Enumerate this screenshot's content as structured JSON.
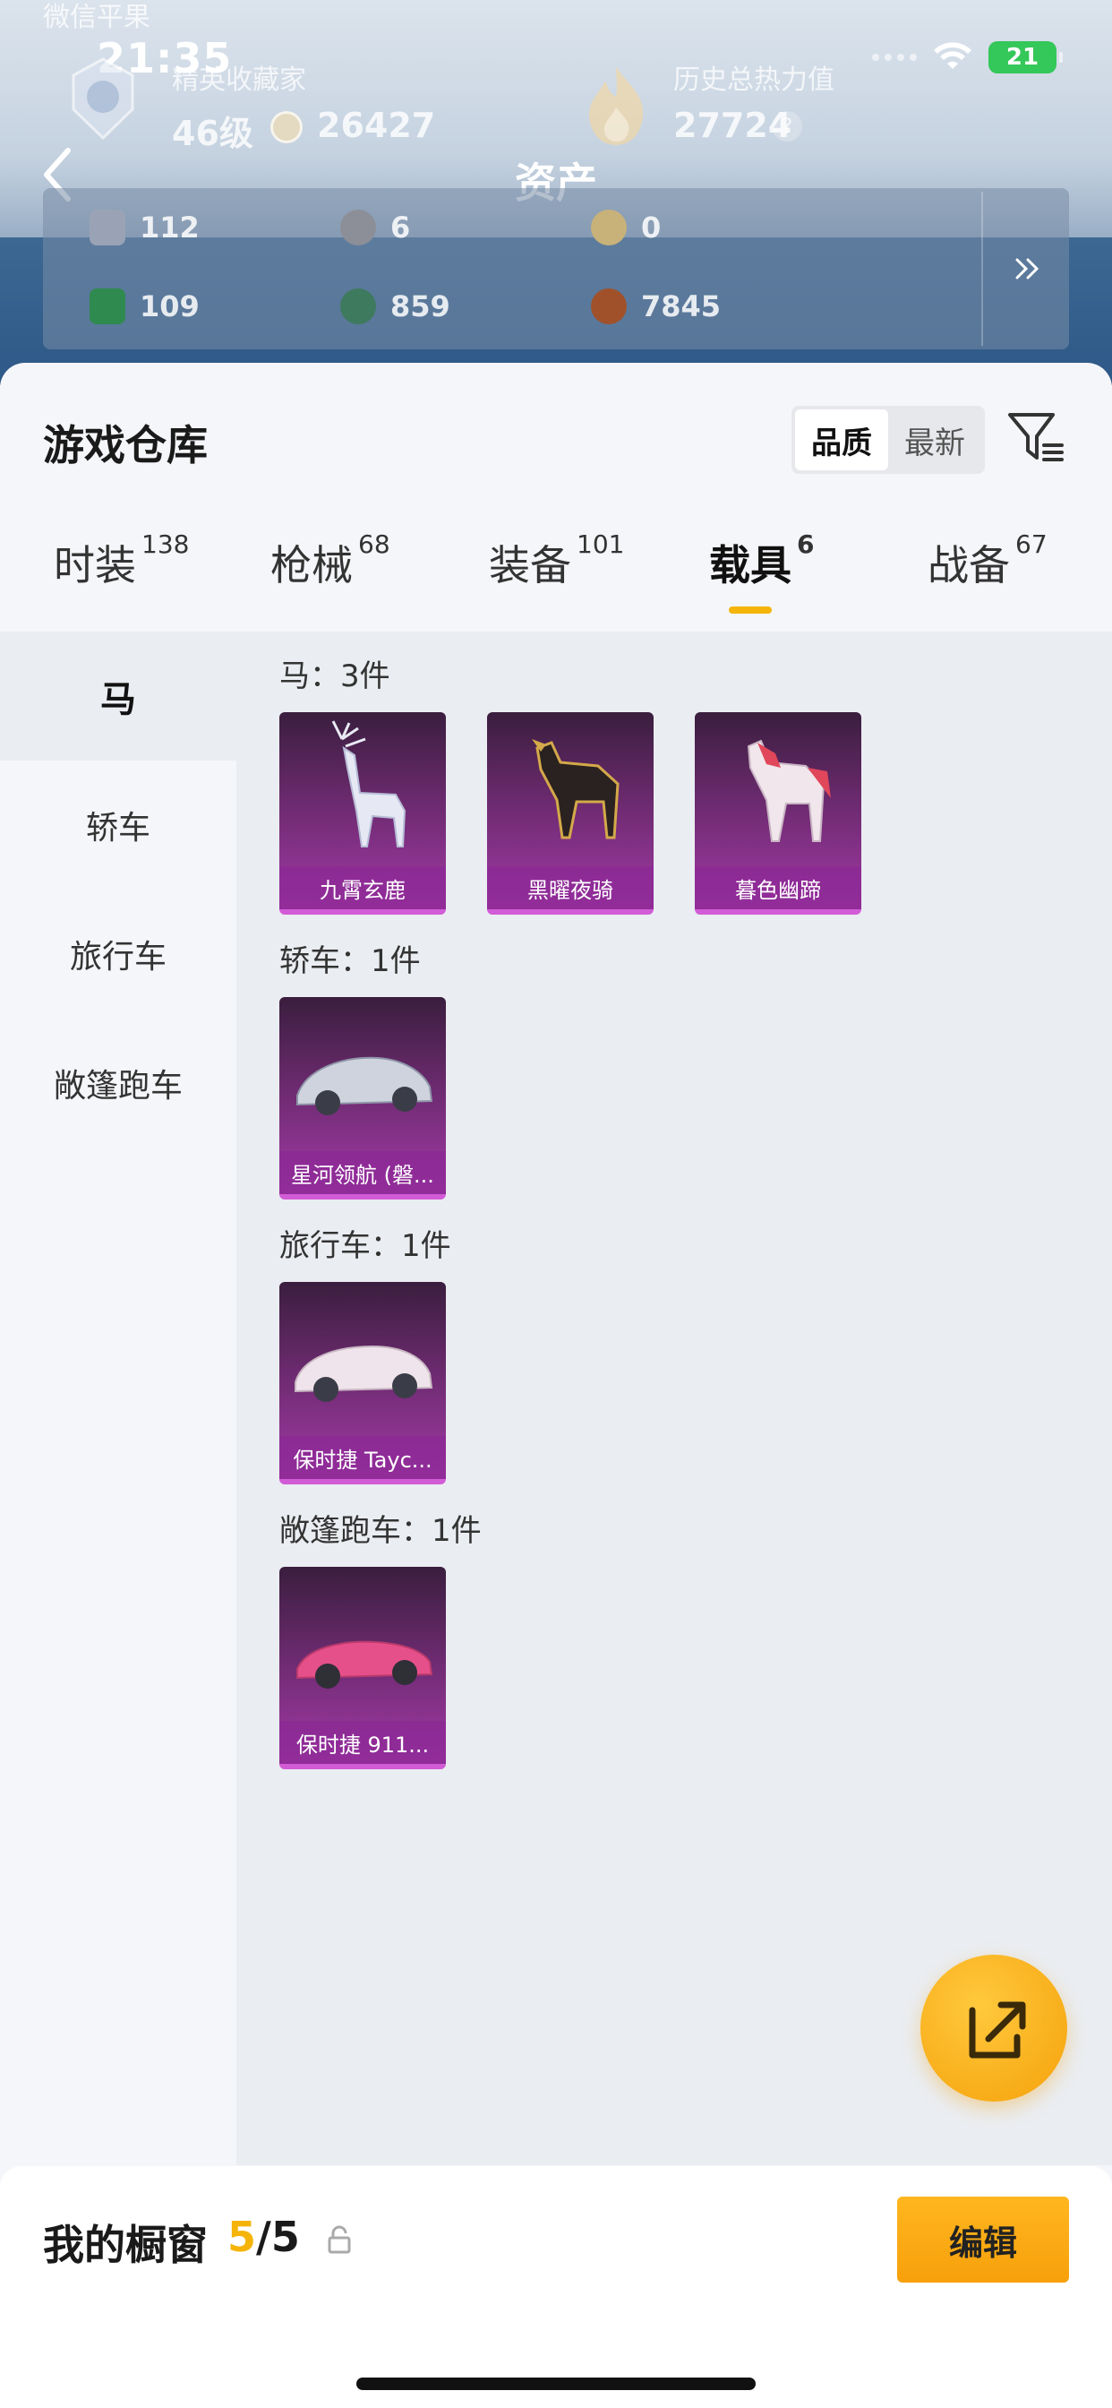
{
  "status_bar": {
    "time": "21:35",
    "carrier_prefix": "微信平果",
    "battery": "21"
  },
  "header": {
    "title": "资产",
    "collector_label": "精英收藏家",
    "collector_level": "46级",
    "collector_points": "26427",
    "heat_label": "历史总热力值",
    "heat_value": "27724",
    "heat_help": "?"
  },
  "assets": [
    {
      "value": "112",
      "color": "#9aa3b5"
    },
    {
      "value": "6",
      "color": "#8c8f98"
    },
    {
      "value": "0",
      "color": "#c8b27a"
    },
    {
      "value": "109",
      "color": "#2f8a4f"
    },
    {
      "value": "859",
      "color": "#3e7a5e"
    },
    {
      "value": "7845",
      "color": "#a0512a"
    }
  ],
  "warehouse": {
    "title": "游戏仓库",
    "sort_options": [
      "品质",
      "最新"
    ],
    "sort_selected": "品质"
  },
  "tabs": [
    {
      "label": "时装",
      "count": "138"
    },
    {
      "label": "枪械",
      "count": "68"
    },
    {
      "label": "装备",
      "count": "101"
    },
    {
      "label": "载具",
      "count": "6",
      "active": true
    },
    {
      "label": "战备",
      "count": "67"
    }
  ],
  "categories": [
    "马",
    "轿车",
    "旅行车",
    "敞篷跑车"
  ],
  "groups": [
    {
      "heading": "马：3件",
      "items": [
        "九霄玄鹿",
        "黑曜夜骑",
        "暮色幽蹄"
      ]
    },
    {
      "heading": "轿车：1件",
      "items": [
        "星河领航 (磐..."
      ]
    },
    {
      "heading": "旅行车：1件",
      "items": [
        "保时捷 Tayc..."
      ]
    },
    {
      "heading": "敞篷跑车：1件",
      "items": [
        "保时捷 911..."
      ]
    }
  ],
  "showcase": {
    "label": "我的橱窗",
    "current": "5",
    "total": "/5"
  },
  "edit_label": "编辑",
  "colors": {
    "accent": "#f5b40a",
    "card_purple": "#a23aa6",
    "battery_green": "#34c759"
  }
}
